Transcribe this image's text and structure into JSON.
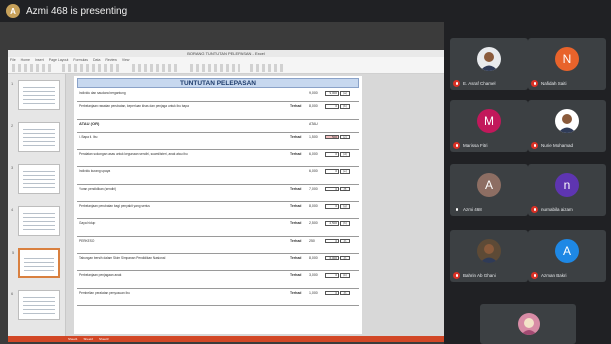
{
  "meeting": {
    "presenter_initial": "A",
    "presenting_text": "Azmi 468 is presenting"
  },
  "excel": {
    "window_title": "BORANG TUNTUTAN PELEPASAN - Excel",
    "ribbon_tabs": [
      "File",
      "Home",
      "Insert",
      "Page Layout",
      "Formulas",
      "Data",
      "Review",
      "View"
    ],
    "thumbnail_numbers": [
      "1",
      "2",
      "3",
      "4",
      "5",
      "6"
    ],
    "sheet_tabs": [
      "Sheet1",
      "Sheet2",
      "Sheet3"
    ],
    "doc_title": "TUNTUTAN PELEPASAN",
    "rows": [
      {
        "label": "Individu dan saudara bergantung",
        "total": "",
        "amount": "9,000",
        "box": "9,000",
        "box2": "(a)",
        "bold": false
      },
      {
        "label": "Perbelanjaan rawatan perubatan, keperluan khas dan penjaga untuk ibu bapa",
        "total": "Terhad",
        "amount": "8,000",
        "box": "0",
        "box2": "(b)",
        "bold": false
      },
      {
        "label": "ATAU (OR)",
        "total": "",
        "amount": "ATAU",
        "box": "",
        "box2": "",
        "bold": true
      },
      {
        "label": "i. Bapa    ii. Ibu",
        "total": "Terhad",
        "amount": "1,500",
        "box": "500",
        "box2": "(c)",
        "bold": false,
        "hl": true
      },
      {
        "label": "Peralatan sokongan asas untuk kegunaan sendiri, suami/isteri, anak atau ibu",
        "total": "Terhad",
        "amount": "6,000",
        "box": "0",
        "box2": "(d)",
        "bold": false
      },
      {
        "label": "Individu kurang upaya",
        "total": "",
        "amount": "6,000",
        "box": "0",
        "box2": "(e)",
        "bold": false
      },
      {
        "label": "Yuran pendidikan (sendiri)",
        "total": "Terhad",
        "amount": "7,000",
        "box": "0",
        "box2": "(f)",
        "bold": false
      },
      {
        "label": "Perbelanjaan perubatan bagi penyakit yang serius",
        "total": "Terhad",
        "amount": "8,000",
        "box": "0",
        "box2": "(g)",
        "bold": false
      },
      {
        "label": "Gaya hidup",
        "total": "Terhad",
        "amount": "2,500",
        "box": "2,500",
        "box2": "(h)",
        "bold": false
      },
      {
        "label": "PERKESO",
        "total": "Terhad",
        "amount": "250",
        "box": "0",
        "box2": "(i)",
        "bold": false
      },
      {
        "label": "Tabungan bersih dalam Skim Simpanan Pendidikan Nasional",
        "total": "Terhad",
        "amount": "8,000",
        "box": "6,000",
        "box2": "(j)",
        "bold": false
      },
      {
        "label": "Perbelanjaan penjagaan anak",
        "total": "Terhad",
        "amount": "3,000",
        "box": "0",
        "box2": "(k)",
        "bold": false
      },
      {
        "label": "Pembelian peralatan penyusuan ibu",
        "total": "Terhad",
        "amount": "1,000",
        "box": "0",
        "box2": "(l)",
        "bold": false
      }
    ]
  },
  "participants": [
    {
      "name": "E. Asraf Chamel",
      "initial": "",
      "color": "#e8eaed",
      "photo": true,
      "mic_muted": true
    },
    {
      "name": "Nafidah Saiti",
      "initial": "N",
      "color": "#e8632b",
      "photo": false,
      "mic_muted": true
    },
    {
      "name": "Marissa Fitri",
      "initial": "M",
      "color": "#c2185b",
      "photo": false,
      "mic_muted": true
    },
    {
      "name": "Nurie Mohamad",
      "initial": "",
      "color": "#ffffff",
      "photo": true,
      "mic_muted": true
    },
    {
      "name": "Azmi 468",
      "initial": "A",
      "color": "#8d6e63",
      "photo": false,
      "mic_muted": false
    },
    {
      "name": "nurnabila aizam",
      "initial": "n",
      "color": "#5e35b1",
      "photo": false,
      "mic_muted": true
    },
    {
      "name": "Bahrin Ab Ghani",
      "initial": "",
      "color": "#5d4a36",
      "photo": true,
      "mic_muted": true
    },
    {
      "name": "Azman Bakri",
      "initial": "A",
      "color": "#1e88e5",
      "photo": false,
      "mic_muted": true
    }
  ],
  "self_view": {
    "name": "You",
    "color": "#d88ca6"
  }
}
